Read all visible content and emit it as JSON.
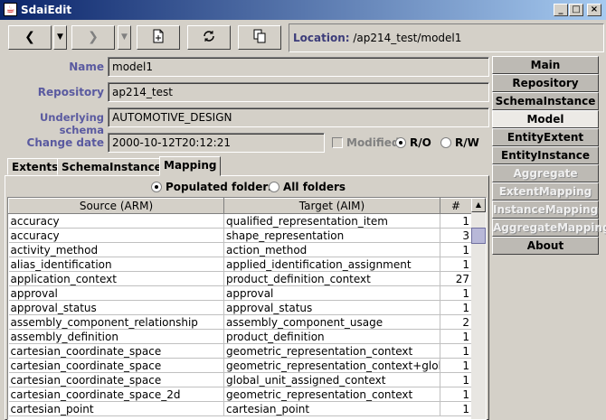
{
  "window": {
    "title": "SdaiEdit",
    "icon": "java-cup-icon",
    "controls": [
      "_",
      "□",
      "×"
    ]
  },
  "toolbar": {
    "back": "❮",
    "forward": "❯",
    "dropdown": "▼",
    "new_icon": "new-document-icon",
    "refresh_icon": "refresh-icon",
    "copy_icon": "copy-icon",
    "location_label": "Location:",
    "location_value": "/ap214_test/model1"
  },
  "form": {
    "name_label": "Name",
    "name_value": "model1",
    "repository_label": "Repository",
    "repository_value": "ap214_test",
    "schema_label": "Underlying schema",
    "schema_value": "AUTOMOTIVE_DESIGN",
    "date_label": "Change date",
    "date_value": "2000-10-12T20:12:21",
    "modified_label": "Modified",
    "ro_label": "R/O",
    "rw_label": "R/W"
  },
  "tabs": [
    "Extents",
    "SchemaInstances",
    "Mapping"
  ],
  "mapping": {
    "populated_label": "Populated folders",
    "all_label": "All folders",
    "columns": [
      "Source (ARM)",
      "Target (AIM)",
      "#"
    ],
    "rows": [
      [
        "accuracy",
        "qualified_representation_item",
        "1"
      ],
      [
        "accuracy",
        "shape_representation",
        "3"
      ],
      [
        "activity_method",
        "action_method",
        "1"
      ],
      [
        "alias_identification",
        "applied_identification_assignment",
        "1"
      ],
      [
        "application_context",
        "product_definition_context",
        "27"
      ],
      [
        "approval",
        "approval",
        "1"
      ],
      [
        "approval_status",
        "approval_status",
        "1"
      ],
      [
        "assembly_component_relationship",
        "assembly_component_usage",
        "2"
      ],
      [
        "assembly_definition",
        "product_definition",
        "1"
      ],
      [
        "cartesian_coordinate_space",
        "geometric_representation_context",
        "1"
      ],
      [
        "cartesian_coordinate_space",
        "geometric_representation_context+globa...",
        "1"
      ],
      [
        "cartesian_coordinate_space",
        "global_unit_assigned_context",
        "1"
      ],
      [
        "cartesian_coordinate_space_2d",
        "geometric_representation_context",
        "1"
      ],
      [
        "cartesian_point",
        "cartesian_point",
        "1"
      ]
    ]
  },
  "nav": {
    "items": [
      "Main",
      "Repository",
      "SchemaInstance",
      "Model",
      "EntityExtent",
      "EntityInstance",
      "Aggregate",
      "ExtentMapping",
      "InstanceMapping",
      "AggregateMapping",
      "About"
    ],
    "active": "Model",
    "disabled": [
      "Aggregate",
      "ExtentMapping",
      "InstanceMapping",
      "AggregateMapping"
    ]
  }
}
